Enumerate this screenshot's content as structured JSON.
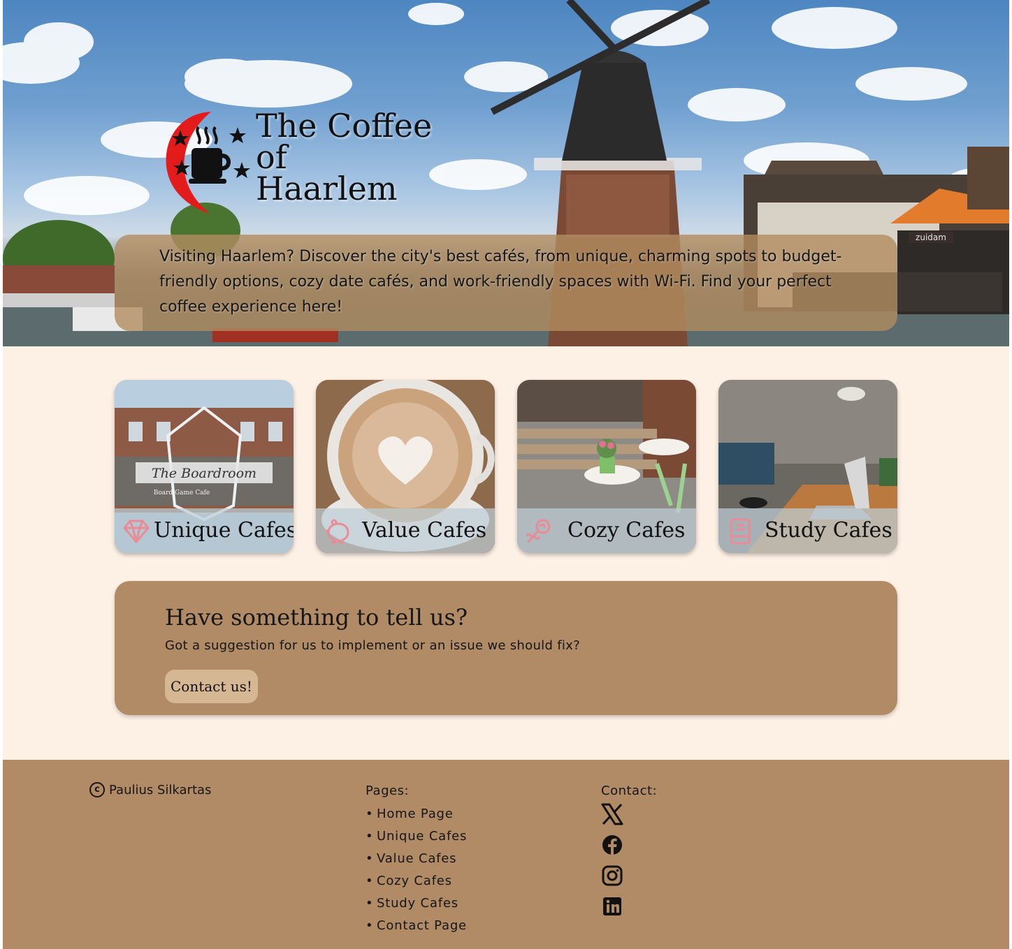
{
  "hero": {
    "site_title": "The Coffee of Haarlem",
    "intro": "Visiting Haarlem? Discover the city's best cafés, from unique, charming spots to budget-friendly options, cozy date cafés, and work-friendly spaces with Wi-Fi. Find your perfect coffee experience here!",
    "shop_sign": "zuidam"
  },
  "cards": [
    {
      "label": "Unique Cafes",
      "icon": "diamond-icon",
      "photo_sign": "The Boardroom",
      "photo_sign_sub": "Board Game Cafe"
    },
    {
      "label": "Value Cafes",
      "icon": "piggy-bank-icon"
    },
    {
      "label": "Cozy Cafes",
      "icon": "rose-icon"
    },
    {
      "label": "Study Cafes",
      "icon": "book-icon"
    }
  ],
  "feedback": {
    "heading": "Have something to tell us?",
    "text": "Got a suggestion for us to implement or an issue we should fix?",
    "button": "Contact us!"
  },
  "footer": {
    "copyright_symbol": "c",
    "copyright_name": "Paulius Silkartas",
    "pages_heading": "Pages:",
    "pages": [
      "Home Page",
      "Unique Cafes",
      "Value Cafes",
      "Cozy Cafes",
      "Study Cafes",
      "Contact Page"
    ],
    "contact_heading": "Contact:",
    "social_icons": [
      "x-icon",
      "facebook-icon",
      "instagram-icon",
      "linkedin-icon"
    ]
  },
  "colors": {
    "page_background": "#fdf0e4",
    "accent_brown": "#b08b66",
    "button": "#d6b793",
    "card_icon": "#e98c96",
    "logo_red": "#e41b1b"
  }
}
